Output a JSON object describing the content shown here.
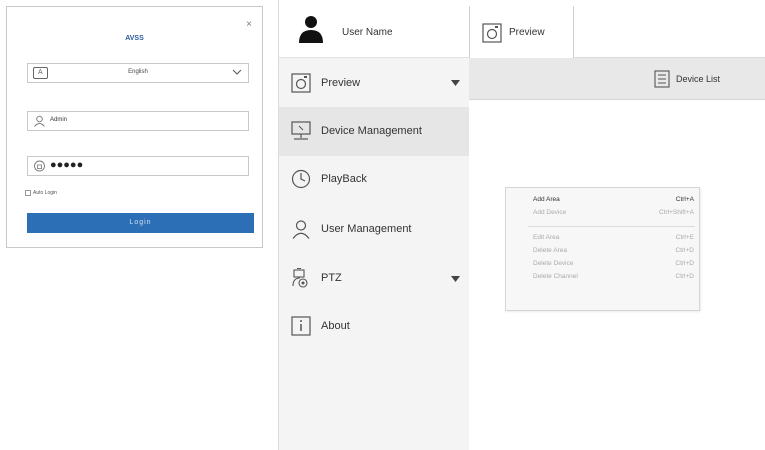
{
  "login": {
    "title": "AVSS",
    "close": "×",
    "language": "English",
    "username": "Admin",
    "password_mask": "●●●●●",
    "remember_label": "Auto Login",
    "login_button": "Login"
  },
  "app": {
    "user_name": "User Name",
    "nav": [
      {
        "label": "Preview",
        "icon": "preview-icon",
        "has_caret": true
      },
      {
        "label": "Device Management",
        "icon": "device-management-icon",
        "active": true
      },
      {
        "label": "PlayBack",
        "icon": "clock-icon"
      },
      {
        "label": "User Management",
        "icon": "user-icon"
      },
      {
        "label": "PTZ",
        "icon": "ptz-camera-icon",
        "has_caret": true
      },
      {
        "label": "About",
        "icon": "info-icon"
      }
    ],
    "top_tab": "Preview",
    "device_list_button": "Device List",
    "context_menu": [
      {
        "label": "Add Area",
        "shortcut": "Ctrl+A",
        "enabled": true
      },
      {
        "label": "Add Device",
        "shortcut": "Ctrl+Shift+A",
        "enabled": false
      },
      {
        "label": "Edit Area",
        "shortcut": "Ctrl+E",
        "enabled": false
      },
      {
        "label": "Delete Area",
        "shortcut": "Ctrl+D",
        "enabled": false
      },
      {
        "label": "Delete Device",
        "shortcut": "Ctrl+D",
        "enabled": false
      },
      {
        "label": "Delete Channel",
        "shortcut": "Ctrl+D",
        "enabled": false
      }
    ]
  },
  "colors": {
    "accent": "#2c6fb7",
    "title_blue": "#2a5a9a",
    "sidebar_bg": "#f4f4f4",
    "active_item_bg": "#e6e6e6"
  }
}
